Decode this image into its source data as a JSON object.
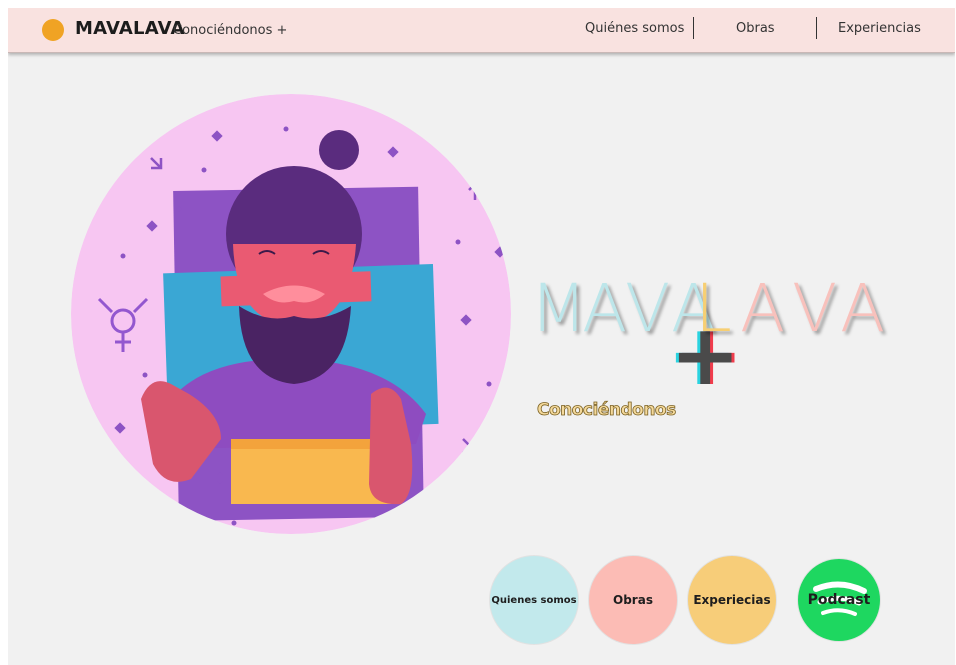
{
  "header": {
    "brand": "MAVALAVA",
    "tagline": "Conociéndonos +",
    "nav": [
      {
        "label": "Quiénes somos"
      },
      {
        "label": "Obras"
      },
      {
        "label": "Experiencias"
      }
    ]
  },
  "hero": {
    "title_letters": [
      "M",
      "A",
      "V",
      "A",
      "L",
      "A",
      "V",
      "A"
    ],
    "plus": "+",
    "subtitle": "Conociéndonos"
  },
  "buttons": [
    {
      "label": "Quienes somos",
      "color": "#c2e9ec"
    },
    {
      "label": "Obras",
      "color": "#fcbcb5"
    },
    {
      "label": "Experiecias",
      "color": "#f7cd79"
    },
    {
      "label": "Podcast",
      "color": "#1ed760"
    }
  ],
  "colors": {
    "accent_dot": "#f0a324",
    "navbar_bg": "#f9e2e0",
    "title_blue": "#bde6ea",
    "title_yellow": "#f7cf73",
    "title_pink": "#f8c1bc"
  }
}
